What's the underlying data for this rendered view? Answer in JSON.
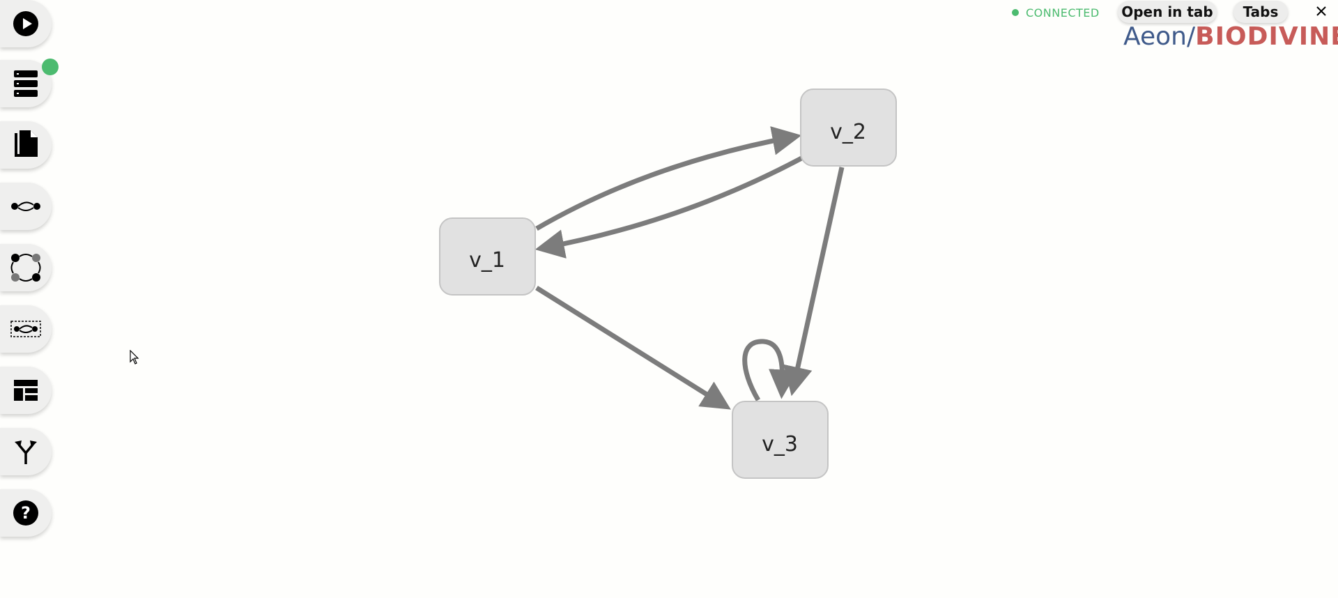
{
  "status": {
    "label": "CONNECTED",
    "color": "#4cbb6f"
  },
  "top_buttons": {
    "open_in_tab": "Open in tab",
    "tabs": "Tabs"
  },
  "brand": {
    "aeon": "Aeon",
    "slash": "/",
    "biodivine": "BIODIVINE"
  },
  "sidebar": {
    "items": [
      {
        "name": "run-icon"
      },
      {
        "name": "server-icon",
        "badge": "online"
      },
      {
        "name": "documents-icon"
      },
      {
        "name": "regulation-icon"
      },
      {
        "name": "network-icon"
      },
      {
        "name": "selection-icon"
      },
      {
        "name": "layout-icon"
      },
      {
        "name": "fork-icon"
      },
      {
        "name": "help-icon"
      }
    ]
  },
  "graph": {
    "nodes": [
      {
        "id": "v_1",
        "label": "v_1"
      },
      {
        "id": "v_2",
        "label": "v_2"
      },
      {
        "id": "v_3",
        "label": "v_3"
      }
    ],
    "edges": [
      {
        "from": "v_1",
        "to": "v_2"
      },
      {
        "from": "v_2",
        "to": "v_1"
      },
      {
        "from": "v_1",
        "to": "v_3"
      },
      {
        "from": "v_2",
        "to": "v_3"
      },
      {
        "from": "v_3",
        "to": "v_3"
      }
    ]
  }
}
